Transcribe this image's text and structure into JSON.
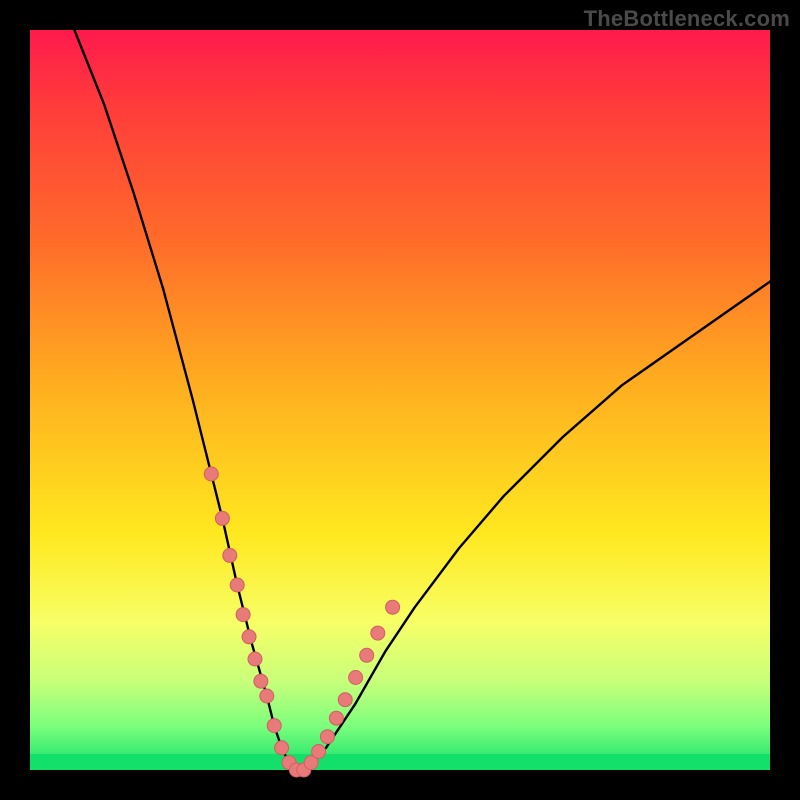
{
  "watermark": "TheBottleneck.com",
  "colors": {
    "frame": "#000000",
    "curve": "#000000",
    "marker": "#e97a7a",
    "marker_stroke": "#d15f5f"
  },
  "chart_data": {
    "type": "line",
    "title": "",
    "xlabel": "",
    "ylabel": "",
    "xlim": [
      0,
      100
    ],
    "ylim": [
      0,
      100
    ],
    "grid": false,
    "legend": false,
    "series": [
      {
        "name": "bottleneck-curve",
        "x": [
          6,
          10,
          14,
          18,
          22,
          26,
          28,
          30,
          32,
          33,
          34,
          35,
          36,
          37,
          38,
          40,
          44,
          48,
          52,
          58,
          64,
          72,
          80,
          90,
          100
        ],
        "y": [
          100,
          90,
          78,
          65,
          50,
          34,
          25,
          17,
          10,
          6,
          3,
          1,
          0,
          0,
          1,
          3,
          9,
          16,
          22,
          30,
          37,
          45,
          52,
          59,
          66
        ]
      }
    ],
    "markers": [
      {
        "name": "highlighted-points",
        "x": [
          24.5,
          26,
          27,
          28,
          28.8,
          29.6,
          30.4,
          31.2,
          32,
          33,
          34,
          35,
          36,
          37,
          38,
          39,
          40.2,
          41.4,
          42.6,
          44,
          45.5,
          47,
          49
        ],
        "y": [
          40,
          34,
          29,
          25,
          21,
          18,
          15,
          12,
          10,
          6,
          3,
          1,
          0,
          0,
          1,
          2.5,
          4.5,
          7,
          9.5,
          12.5,
          15.5,
          18.5,
          22
        ]
      }
    ]
  }
}
